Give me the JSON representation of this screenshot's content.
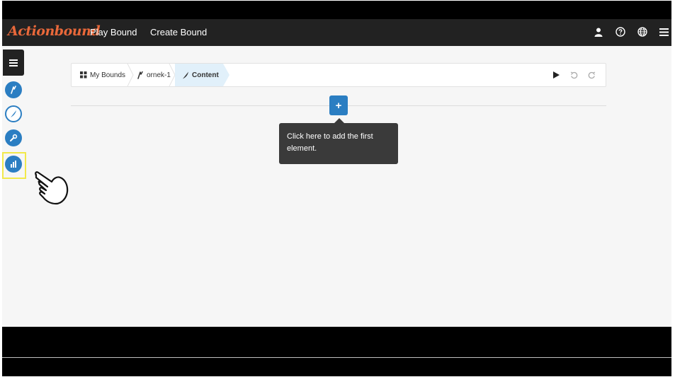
{
  "app": {
    "logo_text": "Actionbound",
    "brand_color": "#e8683a",
    "accent_color": "#2b7ec2"
  },
  "topbar": {
    "nav": [
      {
        "label": "Play Bound"
      },
      {
        "label": "Create Bound"
      }
    ],
    "icons": [
      "user-icon",
      "help-icon",
      "globe-icon",
      "hamburger-menu-icon"
    ]
  },
  "sidebar": {
    "menu_icon": "hamburger-menu-icon",
    "items": [
      {
        "icon": "bound-icon",
        "style": "filled"
      },
      {
        "icon": "feather-pen-icon",
        "style": "outline"
      },
      {
        "icon": "wrench-icon",
        "style": "filled"
      },
      {
        "icon": "bar-chart-icon",
        "style": "filled",
        "highlighted": true
      }
    ]
  },
  "breadcrumb": {
    "home": {
      "label": "My Bounds",
      "icon": "grid-icon"
    },
    "project": {
      "label": "ornek-1",
      "icon": "bound-icon"
    },
    "current": {
      "label": "Content",
      "icon": "feather-icon"
    }
  },
  "toolbar": {
    "icons": [
      "play-icon",
      "undo-icon",
      "redo-icon"
    ]
  },
  "editor": {
    "add_button_label": "+",
    "tooltip_text": "Click here to add the first element."
  },
  "overlay": {
    "pointer_icon": "pointing-hand-icon"
  }
}
